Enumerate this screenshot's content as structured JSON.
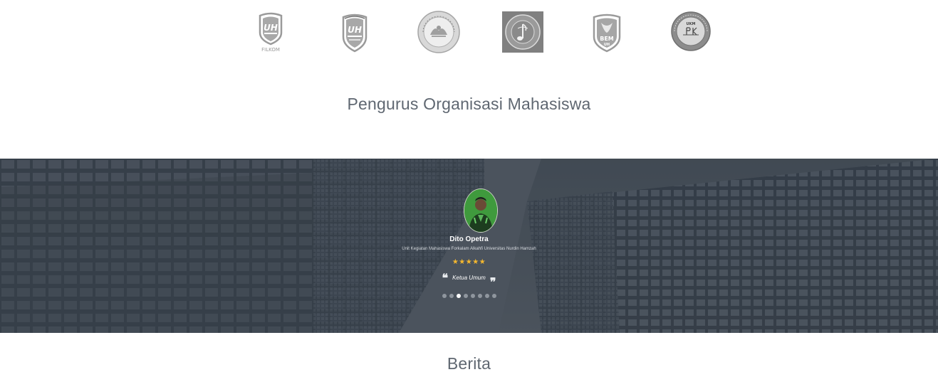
{
  "logos": [
    {
      "name": "uh-filkom-logo",
      "label": "FILKOM"
    },
    {
      "name": "uh-unit-logo",
      "label": ""
    },
    {
      "name": "ukm-circle-seal-logo",
      "label": ""
    },
    {
      "name": "ukm-music-seal-logo",
      "label": ""
    },
    {
      "name": "bem-uh-logo",
      "label": "BEM"
    },
    {
      "name": "ukm-jpk-seal-logo",
      "label": "UKM"
    }
  ],
  "pengurus": {
    "title": "Pengurus Organisasi Mahasiswa"
  },
  "testimonial": {
    "name": "Dito Opetra",
    "organization": "Unit Kegiatan Mahasiswa Forkalam Alkahfi Universitas Nurdin Hamzah",
    "rating": 5,
    "stars": "★★★★★",
    "quote_open": "❝",
    "quote": "Ketua Umum",
    "quote_close": "❞",
    "slides_count": 8,
    "active_slide": 3
  },
  "berita": {
    "title": "Berita"
  }
}
